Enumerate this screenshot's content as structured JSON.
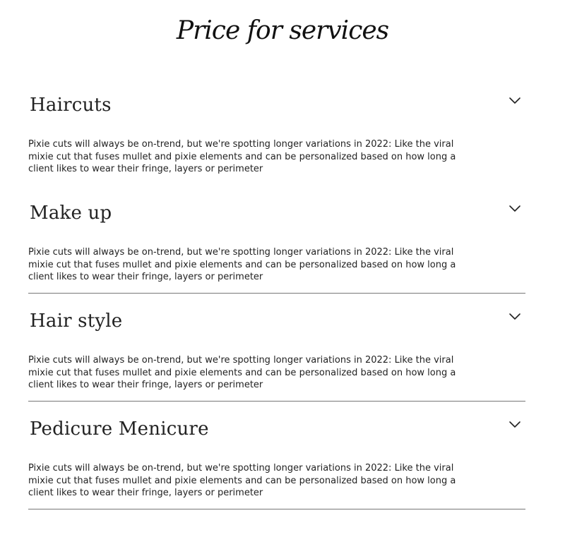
{
  "page": {
    "title": "Price for services"
  },
  "services": [
    {
      "title": "Haircuts",
      "description": "Pixie cuts will always be on-trend, but we're spotting longer variations in 2022: Like the viral mixie cut that fuses mullet and pixie elements and can be personalized based on how long a client likes to wear their fringe, layers or perimeter",
      "toggle_icon": "chevron-down-icon"
    },
    {
      "title": "Make up",
      "description": "Pixie cuts will always be on-trend, but we're spotting longer variations in 2022: Like the viral mixie cut that fuses mullet and pixie elements and can be personalized based on how long a client likes to wear their fringe, layers or perimeter",
      "toggle_icon": "chevron-down-icon"
    },
    {
      "title": "Hair style",
      "description": "Pixie cuts will always be on-trend, but we're spotting longer variations in 2022: Like the viral mixie cut that fuses mullet and pixie elements and can be personalized based on how long a client likes to wear their fringe, layers or perimeter",
      "toggle_icon": "chevron-down-icon"
    },
    {
      "title": "Pedicure Menicure",
      "description": "Pixie cuts will always be on-trend, but we're spotting longer variations in 2022: Like the viral mixie cut that fuses mullet and pixie elements and can be personalized based on how long a client likes to wear their fringe, layers or perimeter",
      "toggle_icon": "chevron-down-icon"
    }
  ],
  "colors": {
    "text": "#222222",
    "divider": "#777777",
    "background": "#ffffff"
  }
}
